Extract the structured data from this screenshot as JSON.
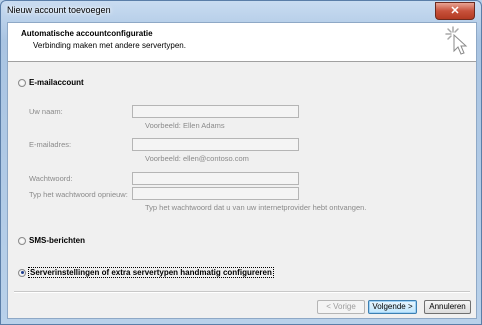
{
  "window": {
    "title": "Nieuw account toevoegen",
    "close_glyph": "✕"
  },
  "header": {
    "title": "Automatische accountconfiguratie",
    "subtitle": "Verbinding maken met andere servertypen.",
    "icon": "wizard-cursor-icon"
  },
  "options": {
    "email": {
      "label": "E-mailaccount",
      "selected": false
    },
    "sms": {
      "label": "SMS-berichten",
      "selected": false
    },
    "manual": {
      "label": "Serverinstellingen of extra servertypen handmatig configureren",
      "selected": true
    }
  },
  "form": {
    "name": {
      "label": "Uw naam:",
      "value": "",
      "hint": "Voorbeeld: Ellen Adams"
    },
    "email": {
      "label": "E-mailadres:",
      "value": "",
      "hint": "Voorbeeld: ellen@contoso.com"
    },
    "password": {
      "label": "Wachtwoord:",
      "value": ""
    },
    "password_repeat": {
      "label": "Typ het wachtwoord opnieuw:",
      "value": "",
      "hint": "Typ het wachtwoord dat u van uw internetprovider hebt ontvangen."
    }
  },
  "buttons": {
    "back": "< Vorige",
    "next": "Volgende >",
    "cancel": "Annuleren"
  },
  "colors": {
    "title_bar": "#b9d1ea",
    "client_bg": "#f0f0f0",
    "default_button": "#bee6fd"
  }
}
